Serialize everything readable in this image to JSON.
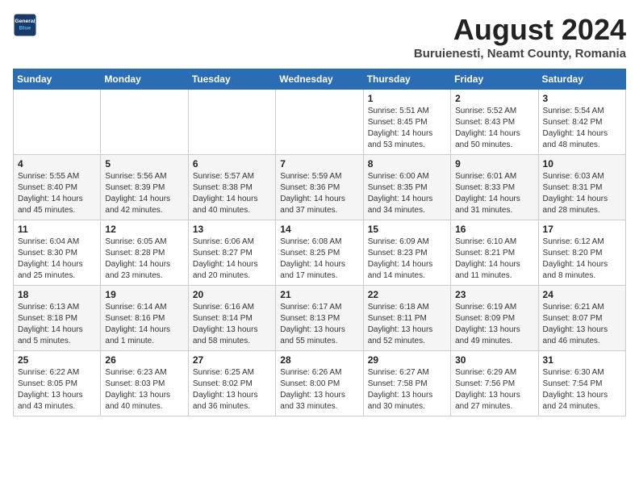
{
  "header": {
    "logo_line1": "General",
    "logo_line2": "Blue",
    "month_year": "August 2024",
    "location": "Buruienesti, Neamt County, Romania"
  },
  "days_of_week": [
    "Sunday",
    "Monday",
    "Tuesday",
    "Wednesday",
    "Thursday",
    "Friday",
    "Saturday"
  ],
  "weeks": [
    [
      {
        "day": "",
        "info": ""
      },
      {
        "day": "",
        "info": ""
      },
      {
        "day": "",
        "info": ""
      },
      {
        "day": "",
        "info": ""
      },
      {
        "day": "1",
        "info": "Sunrise: 5:51 AM\nSunset: 8:45 PM\nDaylight: 14 hours\nand 53 minutes."
      },
      {
        "day": "2",
        "info": "Sunrise: 5:52 AM\nSunset: 8:43 PM\nDaylight: 14 hours\nand 50 minutes."
      },
      {
        "day": "3",
        "info": "Sunrise: 5:54 AM\nSunset: 8:42 PM\nDaylight: 14 hours\nand 48 minutes."
      }
    ],
    [
      {
        "day": "4",
        "info": "Sunrise: 5:55 AM\nSunset: 8:40 PM\nDaylight: 14 hours\nand 45 minutes."
      },
      {
        "day": "5",
        "info": "Sunrise: 5:56 AM\nSunset: 8:39 PM\nDaylight: 14 hours\nand 42 minutes."
      },
      {
        "day": "6",
        "info": "Sunrise: 5:57 AM\nSunset: 8:38 PM\nDaylight: 14 hours\nand 40 minutes."
      },
      {
        "day": "7",
        "info": "Sunrise: 5:59 AM\nSunset: 8:36 PM\nDaylight: 14 hours\nand 37 minutes."
      },
      {
        "day": "8",
        "info": "Sunrise: 6:00 AM\nSunset: 8:35 PM\nDaylight: 14 hours\nand 34 minutes."
      },
      {
        "day": "9",
        "info": "Sunrise: 6:01 AM\nSunset: 8:33 PM\nDaylight: 14 hours\nand 31 minutes."
      },
      {
        "day": "10",
        "info": "Sunrise: 6:03 AM\nSunset: 8:31 PM\nDaylight: 14 hours\nand 28 minutes."
      }
    ],
    [
      {
        "day": "11",
        "info": "Sunrise: 6:04 AM\nSunset: 8:30 PM\nDaylight: 14 hours\nand 25 minutes."
      },
      {
        "day": "12",
        "info": "Sunrise: 6:05 AM\nSunset: 8:28 PM\nDaylight: 14 hours\nand 23 minutes."
      },
      {
        "day": "13",
        "info": "Sunrise: 6:06 AM\nSunset: 8:27 PM\nDaylight: 14 hours\nand 20 minutes."
      },
      {
        "day": "14",
        "info": "Sunrise: 6:08 AM\nSunset: 8:25 PM\nDaylight: 14 hours\nand 17 minutes."
      },
      {
        "day": "15",
        "info": "Sunrise: 6:09 AM\nSunset: 8:23 PM\nDaylight: 14 hours\nand 14 minutes."
      },
      {
        "day": "16",
        "info": "Sunrise: 6:10 AM\nSunset: 8:21 PM\nDaylight: 14 hours\nand 11 minutes."
      },
      {
        "day": "17",
        "info": "Sunrise: 6:12 AM\nSunset: 8:20 PM\nDaylight: 14 hours\nand 8 minutes."
      }
    ],
    [
      {
        "day": "18",
        "info": "Sunrise: 6:13 AM\nSunset: 8:18 PM\nDaylight: 14 hours\nand 5 minutes."
      },
      {
        "day": "19",
        "info": "Sunrise: 6:14 AM\nSunset: 8:16 PM\nDaylight: 14 hours\nand 1 minute."
      },
      {
        "day": "20",
        "info": "Sunrise: 6:16 AM\nSunset: 8:14 PM\nDaylight: 13 hours\nand 58 minutes."
      },
      {
        "day": "21",
        "info": "Sunrise: 6:17 AM\nSunset: 8:13 PM\nDaylight: 13 hours\nand 55 minutes."
      },
      {
        "day": "22",
        "info": "Sunrise: 6:18 AM\nSunset: 8:11 PM\nDaylight: 13 hours\nand 52 minutes."
      },
      {
        "day": "23",
        "info": "Sunrise: 6:19 AM\nSunset: 8:09 PM\nDaylight: 13 hours\nand 49 minutes."
      },
      {
        "day": "24",
        "info": "Sunrise: 6:21 AM\nSunset: 8:07 PM\nDaylight: 13 hours\nand 46 minutes."
      }
    ],
    [
      {
        "day": "25",
        "info": "Sunrise: 6:22 AM\nSunset: 8:05 PM\nDaylight: 13 hours\nand 43 minutes."
      },
      {
        "day": "26",
        "info": "Sunrise: 6:23 AM\nSunset: 8:03 PM\nDaylight: 13 hours\nand 40 minutes."
      },
      {
        "day": "27",
        "info": "Sunrise: 6:25 AM\nSunset: 8:02 PM\nDaylight: 13 hours\nand 36 minutes."
      },
      {
        "day": "28",
        "info": "Sunrise: 6:26 AM\nSunset: 8:00 PM\nDaylight: 13 hours\nand 33 minutes."
      },
      {
        "day": "29",
        "info": "Sunrise: 6:27 AM\nSunset: 7:58 PM\nDaylight: 13 hours\nand 30 minutes."
      },
      {
        "day": "30",
        "info": "Sunrise: 6:29 AM\nSunset: 7:56 PM\nDaylight: 13 hours\nand 27 minutes."
      },
      {
        "day": "31",
        "info": "Sunrise: 6:30 AM\nSunset: 7:54 PM\nDaylight: 13 hours\nand 24 minutes."
      }
    ]
  ]
}
